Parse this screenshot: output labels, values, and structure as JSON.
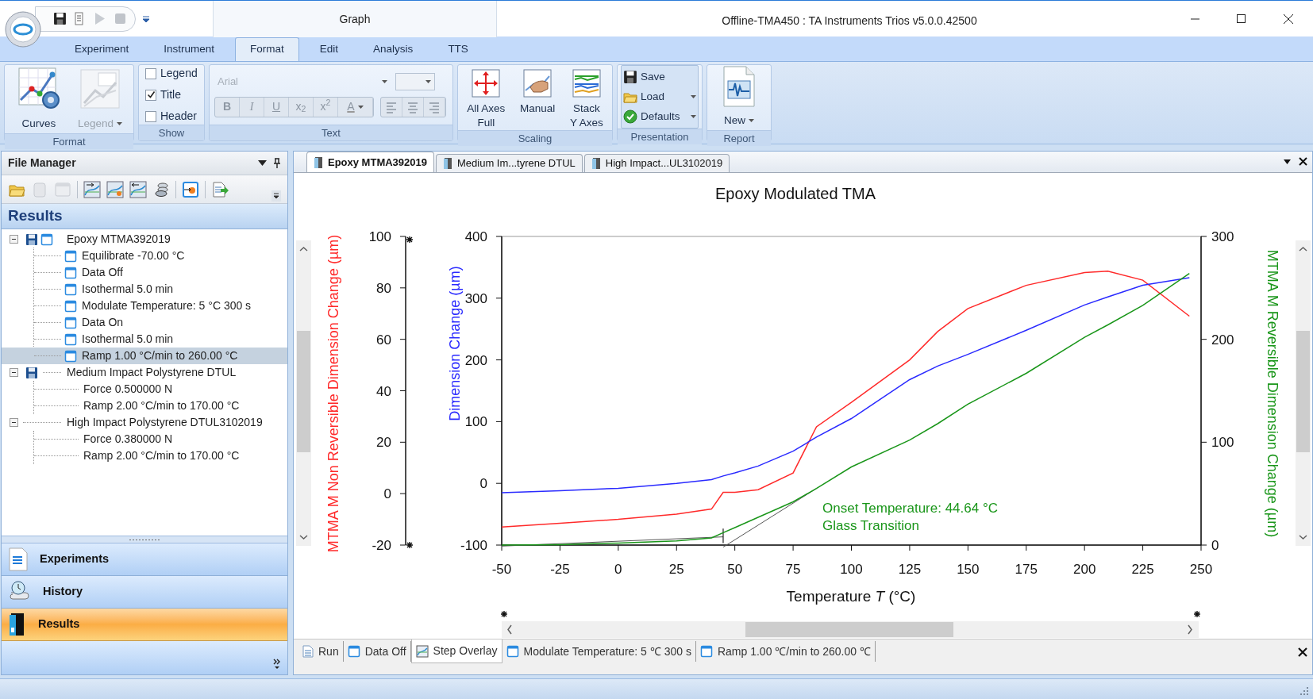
{
  "title_bar": {
    "contextual_group": "Graph",
    "title": "Offline-TMA450 : TA Instruments Trios v5.0.0.42500"
  },
  "ribbon_tabs": [
    {
      "label": "Experiment",
      "selected": false
    },
    {
      "label": "Instrument",
      "selected": false
    },
    {
      "label": "Format",
      "selected": true
    },
    {
      "label": "Edit",
      "selected": false
    },
    {
      "label": "Analysis",
      "selected": false
    },
    {
      "label": "TTS",
      "selected": false
    }
  ],
  "ribbon_groups": [
    {
      "kind": "format",
      "label": "Format",
      "buttons": [
        {
          "label": "Curves",
          "disabled": false,
          "dropdown": false
        },
        {
          "label": "Legend",
          "disabled": true,
          "dropdown": true
        }
      ]
    },
    {
      "kind": "show",
      "label": "Show",
      "checkboxes": [
        {
          "label": "Legend",
          "checked": false
        },
        {
          "label": "Title",
          "checked": true
        },
        {
          "label": "Header",
          "checked": false
        }
      ]
    },
    {
      "kind": "text",
      "label": "Text",
      "disabled": true,
      "font": "Arial",
      "buttons": [
        "B",
        "I",
        "U",
        "x$_{2}$",
        "x$^{2}$",
        "A"
      ]
    },
    {
      "kind": "scaling",
      "label": "Scaling",
      "buttons": [
        {
          "lines": [
            "All Axes",
            "Full"
          ]
        },
        {
          "lines": [
            "Manual"
          ]
        },
        {
          "lines": [
            "Stack",
            "Y Axes"
          ]
        }
      ]
    },
    {
      "kind": "presentation",
      "label": "Presentation",
      "buttons": [
        {
          "label": "Save",
          "dropdown": false
        },
        {
          "label": "Load",
          "dropdown": true
        },
        {
          "label": "Defaults",
          "dropdown": true
        }
      ]
    },
    {
      "kind": "report",
      "label": "Report",
      "buttons": [
        {
          "label": "New",
          "dropdown": true
        }
      ]
    }
  ],
  "file_manager": {
    "title": "File Manager",
    "section": "Results",
    "tree": [
      {
        "label": "Epoxy MTMA392019",
        "kind": "open_file",
        "expanded": true,
        "selected": false,
        "children": [
          {
            "label": "Equilibrate -70.00 °C",
            "kind": "step",
            "selected": false
          },
          {
            "label": "Data Off",
            "kind": "step",
            "selected": false
          },
          {
            "label": "Isothermal 5.0 min",
            "kind": "step",
            "selected": false
          },
          {
            "label": "Modulate Temperature: 5 °C 300 s",
            "kind": "step",
            "selected": false
          },
          {
            "label": "Data On",
            "kind": "step",
            "selected": false
          },
          {
            "label": "Isothermal 5.0 min",
            "kind": "step",
            "selected": false
          },
          {
            "label": "Ramp 1.00 °C/min to 260.00 °C",
            "kind": "step",
            "selected": true
          }
        ]
      },
      {
        "label": "Medium Impact Polystyrene DTUL",
        "kind": "saved_file",
        "expanded": true,
        "selected": false,
        "children": [
          {
            "label": "Force 0.500000 N",
            "kind": "parameter",
            "selected": false
          },
          {
            "label": "Ramp 2.00 °C/min to 170.00 °C",
            "kind": "parameter",
            "selected": false
          }
        ]
      },
      {
        "label": "High Impact Polystyrene DTUL3102019",
        "kind": "file",
        "expanded": true,
        "selected": false,
        "children": [
          {
            "label": "Force 0.380000 N",
            "kind": "parameter",
            "selected": false
          },
          {
            "label": "Ramp 2.00 °C/min to 170.00 °C",
            "kind": "parameter",
            "selected": false
          }
        ]
      }
    ],
    "nav": [
      {
        "label": "Experiments",
        "kind": "experiments",
        "selected": false
      },
      {
        "label": "History",
        "kind": "history",
        "selected": false
      },
      {
        "label": "Results",
        "kind": "results",
        "selected": true
      }
    ]
  },
  "document": {
    "tabs": [
      {
        "label": "Epoxy MTMA392019",
        "selected": true
      },
      {
        "label": "Medium Im...tyrene DTUL",
        "selected": false
      },
      {
        "label": "High Impact...UL3102019",
        "selected": false
      }
    ],
    "chart": {
      "chart_data": {
        "type": "line",
        "title": "Epoxy Modulated TMA",
        "xlabel": "Temperature *T* (°C)",
        "x": [
          -50,
          -25,
          0,
          25,
          40,
          45,
          50,
          60,
          75,
          85,
          100,
          125,
          137,
          150,
          175,
          200,
          210,
          225,
          245
        ],
        "xlim": [
          -50,
          250
        ],
        "xticks": [
          -50,
          -25,
          0,
          25,
          50,
          75,
          100,
          125,
          150,
          175,
          200,
          225,
          250
        ],
        "ylabel": "Dimension Change  (µm)",
        "ylim": [
          -100,
          400
        ],
        "yticks": [
          -100,
          0,
          100,
          200,
          300,
          400
        ],
        "y2label": "MTMA M Non Reversible Dimension Change  (µm)",
        "y2lim": [
          -20,
          100
        ],
        "y2ticks": [
          -20,
          0,
          20,
          40,
          60,
          80,
          100
        ],
        "y3label": "MTMA M Reversible Dimension Change  (µm)",
        "y3lim": [
          0,
          300
        ],
        "y3ticks": [
          0,
          100,
          200,
          300
        ],
        "series": [
          {
            "color": "#ff2a2a",
            "axis": "y2",
            "values": [
              -13,
              -11.5,
              -10,
              -8,
              -6,
              0.5,
              0.5,
              1.5,
              8,
              26,
              35.5,
              52,
              63,
              72,
              81,
              86,
              86.5,
              83,
              69
            ]
          },
          {
            "color": "#2a2aff",
            "values": [
              -15,
              -12,
              -8,
              0,
              6,
              12,
              17,
              28,
              52,
              75,
              105,
              168,
              190,
              209,
              248,
              289,
              302,
              321,
              333
            ]
          },
          {
            "color": "#1a961a",
            "axis": "y3",
            "values": [
              0,
              0.5,
              2,
              4,
              7,
              12,
              17,
              27,
              42,
              55,
              76,
              102,
              118,
              137,
              167,
              202,
              214,
              233,
              264
            ]
          }
        ],
        "annotations": [
          "Onset Temperature: 44.64 °C",
          "Glass Transition"
        ]
      }
    },
    "step_tabs": [
      {
        "label": "Run",
        "kind": "run",
        "selected": false
      },
      {
        "label": "Data Off",
        "kind": "step",
        "selected": false
      },
      {
        "label": "Step Overlay",
        "kind": "overlay",
        "selected": true
      },
      {
        "label": "Modulate Temperature: 5 ℃ 300 s",
        "kind": "step",
        "selected": false
      },
      {
        "label": "Ramp 1.00 ℃/min to 260.00 ℃",
        "kind": "step",
        "selected": false
      }
    ]
  }
}
